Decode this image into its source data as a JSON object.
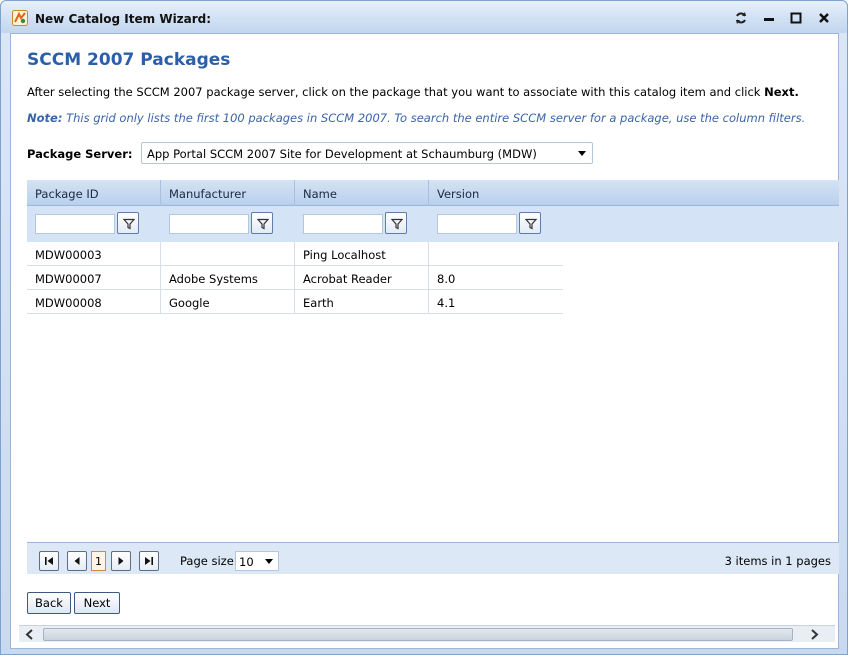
{
  "window": {
    "title": "New Catalog Item Wizard:"
  },
  "page": {
    "title": "SCCM 2007 Packages",
    "instructions": "After selecting the SCCM 2007 package server, click on the package that you want to associate with this catalog item and click ",
    "instructions_bold": "Next.",
    "note_label": "Note:",
    "note_text": " This grid only lists the first 100 packages in SCCM 2007. To search the entire SCCM server for a package, use the column filters."
  },
  "server": {
    "label": "Package Server:",
    "value": "App Portal SCCM 2007 Site for Development at Schaumburg (MDW)"
  },
  "grid": {
    "columns": [
      "Package ID",
      "Manufacturer",
      "Name",
      "Version"
    ],
    "rows": [
      [
        "MDW00003",
        "",
        "Ping Localhost",
        ""
      ],
      [
        "MDW00007",
        "Adobe Systems",
        "Acrobat Reader",
        "8.0"
      ],
      [
        "MDW00008",
        "Google",
        "Earth",
        "4.1"
      ]
    ]
  },
  "pager": {
    "current_page": "1",
    "page_size_label": "Page size:",
    "page_size": "10",
    "info": "3 items in 1 pages"
  },
  "buttons": {
    "back": "Back",
    "next": "Next"
  },
  "icons": {
    "app": "catalog-wizard-icon",
    "refresh": "refresh-icon",
    "minimize": "minimize-icon",
    "maximize": "maximize-icon",
    "close": "close-icon",
    "filter": "filter-funnel-icon"
  },
  "colors": {
    "accent_title": "#2c5fa8",
    "note": "#3a64a8",
    "header_bg": "#b9d0ec",
    "current_page_border": "#d08a3c"
  }
}
